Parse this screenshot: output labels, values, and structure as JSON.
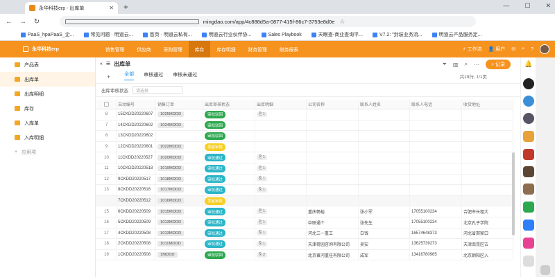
{
  "browser": {
    "tab_title": "永华科技erp - 出库单",
    "url": "mingdao.com/app/4c888d5a-0877-415f-86c7-3753e8d0e1f8/62bba1ee7755039554e7705c/62bba1eed608f875396d9027/62bba1e...",
    "update_label": "更新"
  },
  "bookmarks": [
    "PaaS_hpaPaaS_企...",
    "常见问题 · 明道云...",
    "首页 · 明道云私有...",
    "明道云行业伙伴协...",
    "Sales Playbook",
    "天眼查-商业查询平...",
    "V7.2: \"封装业务流...",
    "明道云产品服务定..."
  ],
  "app": {
    "name": "永华科技erp",
    "nav": [
      "销售管理",
      "供应商",
      "采购管理",
      "库存",
      "库存明细",
      "财务管理",
      "财务报表"
    ],
    "right": [
      "工作流",
      "用户"
    ]
  },
  "sidebar": {
    "items": [
      "产品表",
      "出库单",
      "出库明细",
      "库存",
      "入库单",
      "入库明细"
    ],
    "add_label": "应用项"
  },
  "page": {
    "title": "出库单",
    "tabs": [
      "全部",
      "审核通过",
      "审核未通过"
    ],
    "count": "共19行, 1/1页",
    "add_label": "+ 记录",
    "filter_label": "出库审核状态",
    "filter_placeholder": "请选择"
  },
  "table": {
    "headers": [
      "",
      "自动编号",
      "销售订单",
      "出库审核状态",
      "出库明细",
      "公司名称",
      "联系人姓名",
      "联系人电话",
      "收货地址"
    ],
    "rows": [
      {
        "n": "8",
        "id": "15CKDD20220607",
        "so": "1025MDDD",
        "st": "审批驳回",
        "att": "1",
        "co": "",
        "cn": "",
        "tel": "",
        "addr": ""
      },
      {
        "n": "7",
        "id": "14CKDD20220602",
        "so": "1024MDDD",
        "st": "审批驳回",
        "att": "",
        "co": "",
        "cn": "",
        "tel": "",
        "addr": ""
      },
      {
        "n": "8",
        "id": "13CKDD20220602",
        "so": "",
        "st": "审批驳回",
        "att": "",
        "co": "",
        "cn": "",
        "tel": "",
        "addr": ""
      },
      {
        "n": "9",
        "id": "12CKDD20220601",
        "so": "1022MDDD",
        "st": "发起审批",
        "att": "",
        "co": "",
        "cn": "",
        "tel": "",
        "addr": ""
      },
      {
        "n": "10",
        "id": "11CKDD20220527",
        "so": "1020MDDD",
        "st": "审批通过",
        "att": "1",
        "co": "",
        "cn": "",
        "tel": "",
        "addr": ""
      },
      {
        "n": "11",
        "id": "10CKDD20220518",
        "so": "1019MDDD",
        "st": "审批通过",
        "att": "1",
        "co": "",
        "cn": "",
        "tel": "",
        "addr": ""
      },
      {
        "n": "12",
        "id": "9CKDD20220517",
        "so": "1018MDDD",
        "st": "审批通过",
        "att": "1",
        "co": "",
        "cn": "",
        "tel": "",
        "addr": ""
      },
      {
        "n": "13",
        "id": "8CKDD20220516",
        "so": "1017MDDD",
        "st": "审批通过",
        "att": "1",
        "co": "",
        "cn": "",
        "tel": "",
        "addr": ""
      },
      {
        "n": "",
        "id": "7CKDD20220512",
        "so": "1016MDDD",
        "st": "发起审批",
        "att": "",
        "co": "",
        "cn": "",
        "tel": "",
        "addr": ""
      },
      {
        "n": "15",
        "id": "6CKDD20220509",
        "so": "1015MDDD",
        "st": "审批通过",
        "att": "1",
        "co": "重庆畅裕",
        "cn": "张小军",
        "tel": "17055100234",
        "addr": "合肥市长租大"
      },
      {
        "n": "16",
        "id": "5CKDD20220509",
        "so": "1013MDDD",
        "st": "审批通过",
        "att": "1",
        "co": "中联通个",
        "cn": "张先生",
        "tel": "17055100234",
        "addr": "北京孔子学院"
      },
      {
        "n": "17",
        "id": "4CKDD20220508",
        "so": "1013MDDD",
        "st": "审批通过",
        "att": "1",
        "co": "河北三一重工",
        "cn": "白钱",
        "tel": "16574648373",
        "addr": "河北省邢家口"
      },
      {
        "n": "18",
        "id": "2CKDD20220508",
        "so": "1011MDDD",
        "st": "审批通过",
        "att": "1",
        "co": "天津荷园咨询有限公司",
        "cn": "吴安",
        "tel": "13625739273",
        "addr": "天津南昆区古"
      },
      {
        "n": "19",
        "id": "1CKDD20220508",
        "so": "1MDDD",
        "st": "审批驳回",
        "att": "2",
        "co": "北京黄河重任有限公司",
        "cn": "成军",
        "tel": "13416780965",
        "addr": "北京朝阳区入"
      }
    ]
  },
  "colors": {
    "brand": "#f6921e",
    "approved": "#2bb5c8",
    "rejected": "#2ea84f",
    "pending": "#f7cf24"
  }
}
